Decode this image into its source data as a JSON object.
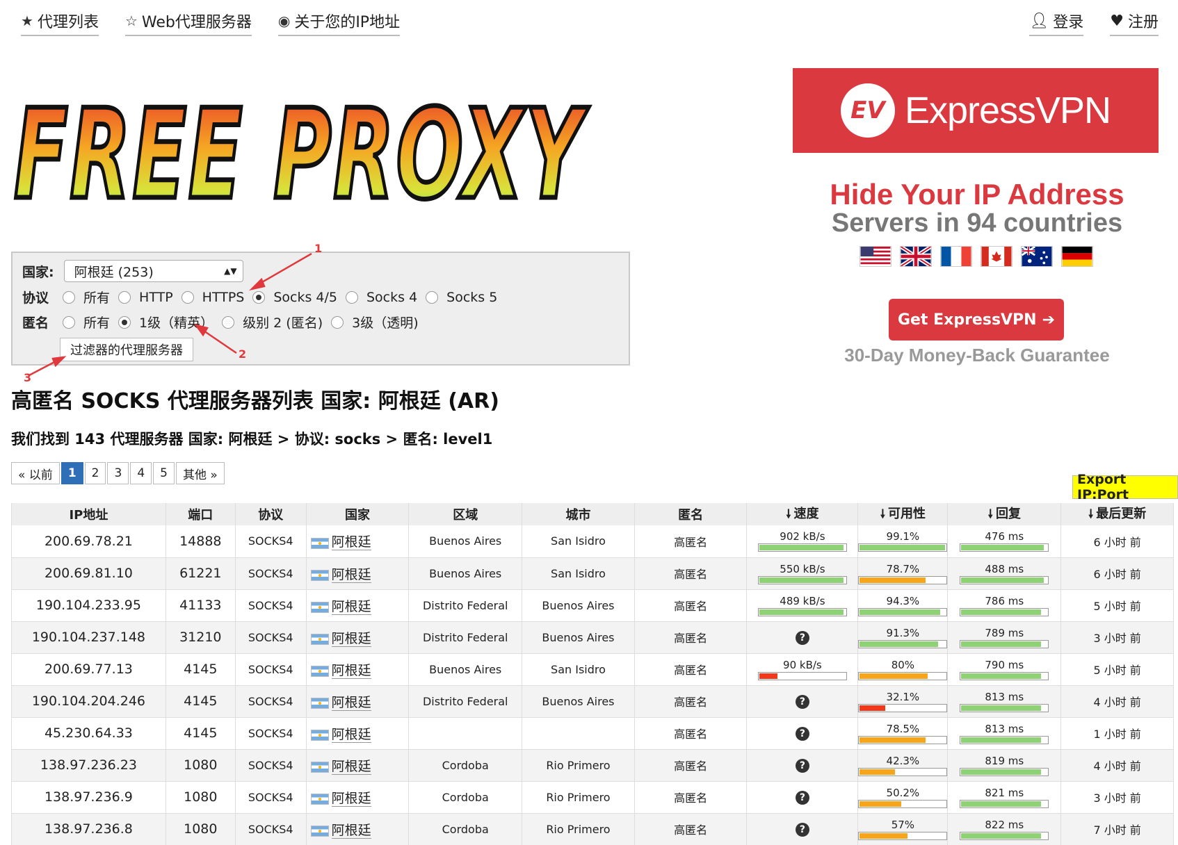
{
  "nav": {
    "left": [
      {
        "icon": "star-icon",
        "label": "代理列表"
      },
      {
        "icon": "star-outline-icon",
        "label": "Web代理服务器"
      },
      {
        "icon": "eye-icon",
        "label": "关于您的IP地址"
      }
    ],
    "right": [
      {
        "icon": "user-icon",
        "label": "登录"
      },
      {
        "icon": "heart-icon",
        "label": "注册"
      }
    ]
  },
  "logo": {
    "text": "FREE PROXY"
  },
  "ad": {
    "brand": "ExpressVPN",
    "logo_text": "EV",
    "headline": "Hide Your IP Address",
    "sub": "Servers in 94 countries",
    "cta": "Get ExpressVPN",
    "guarantee": "30-Day Money-Back Guarantee",
    "brand_color": "#da3940"
  },
  "filter": {
    "country_label": "国家:",
    "country_value": "阿根廷 (253)",
    "protocol_label": "协议",
    "protocol_options": [
      "所有",
      "HTTP",
      "HTTPS",
      "Socks 4/5",
      "Socks 4",
      "Socks 5"
    ],
    "protocol_selected": 3,
    "anon_label": "匿名",
    "anon_options": [
      "所有",
      "1级（精英）",
      "级别 2 (匿名)",
      "3级（透明)"
    ],
    "anon_selected": 1,
    "filter_button": "过滤器的代理服务器",
    "annotations": [
      "1",
      "2",
      "3"
    ]
  },
  "title": "高匿名 SOCKS 代理服务器列表 国家: 阿根廷 (AR)",
  "summary": "我们找到 143 代理服务器 国家: 阿根廷 > 协议: socks > 匿名: level1",
  "pager": {
    "prev": "« 以前",
    "pages": [
      "1",
      "2",
      "3",
      "4",
      "5"
    ],
    "active": 0,
    "next": "其他 »"
  },
  "export_label": "Export IP:Port",
  "table": {
    "headers": [
      "IP地址",
      "端口",
      "协议",
      "国家",
      "区域",
      "城市",
      "匿名",
      "速度",
      "可用性",
      "回复",
      "最后更新"
    ],
    "rows": [
      {
        "ip": "200.69.78.21",
        "port": "14888",
        "proto": "SOCKS4",
        "country": "阿根廷",
        "region": "Buenos Aires",
        "city": "San Isidro",
        "anon": "高匿名",
        "speed": "902 kB/s",
        "speed_pct": 98,
        "speed_color": "#8fd175",
        "uptime": "99.1%",
        "uptime_pct": 99,
        "uptime_color": "#8fd175",
        "resp": "476 ms",
        "resp_pct": 96,
        "resp_color": "#8fd175",
        "updated": "6 小时 前"
      },
      {
        "ip": "200.69.81.10",
        "port": "61221",
        "proto": "SOCKS4",
        "country": "阿根廷",
        "region": "Buenos Aires",
        "city": "San Isidro",
        "anon": "高匿名",
        "speed": "550 kB/s",
        "speed_pct": 98,
        "speed_color": "#8fd175",
        "uptime": "78.7%",
        "uptime_pct": 77,
        "uptime_color": "#f7a51b",
        "resp": "488 ms",
        "resp_pct": 96,
        "resp_color": "#8fd175",
        "updated": "6 小时 前"
      },
      {
        "ip": "190.104.233.95",
        "port": "41133",
        "proto": "SOCKS4",
        "country": "阿根廷",
        "region": "Distrito Federal",
        "city": "Buenos Aires",
        "anon": "高匿名",
        "speed": "489 kB/s",
        "speed_pct": 98,
        "speed_color": "#8fd175",
        "uptime": "94.3%",
        "uptime_pct": 93,
        "uptime_color": "#8fd175",
        "resp": "786 ms",
        "resp_pct": 93,
        "resp_color": "#8fd175",
        "updated": "5 小时 前"
      },
      {
        "ip": "190.104.237.148",
        "port": "31210",
        "proto": "SOCKS4",
        "country": "阿根廷",
        "region": "Distrito Federal",
        "city": "Buenos Aires",
        "anon": "高匿名",
        "speed": null,
        "uptime": "91.3%",
        "uptime_pct": 91,
        "uptime_color": "#8fd175",
        "resp": "789 ms",
        "resp_pct": 93,
        "resp_color": "#8fd175",
        "updated": "3 小时 前"
      },
      {
        "ip": "200.69.77.13",
        "port": "4145",
        "proto": "SOCKS4",
        "country": "阿根廷",
        "region": "Buenos Aires",
        "city": "San Isidro",
        "anon": "高匿名",
        "speed": "90 kB/s",
        "speed_pct": 22,
        "speed_color": "#f2371b",
        "uptime": "80%",
        "uptime_pct": 79,
        "uptime_color": "#f7a51b",
        "resp": "790 ms",
        "resp_pct": 93,
        "resp_color": "#8fd175",
        "updated": "5 小时 前"
      },
      {
        "ip": "190.104.204.246",
        "port": "4145",
        "proto": "SOCKS4",
        "country": "阿根廷",
        "region": "Distrito Federal",
        "city": "Buenos Aires",
        "anon": "高匿名",
        "speed": null,
        "uptime": "32.1%",
        "uptime_pct": 31,
        "uptime_color": "#f2371b",
        "resp": "813 ms",
        "resp_pct": 93,
        "resp_color": "#8fd175",
        "updated": "4 小时 前"
      },
      {
        "ip": "45.230.64.33",
        "port": "4145",
        "proto": "SOCKS4",
        "country": "阿根廷",
        "region": "",
        "city": "",
        "anon": "高匿名",
        "speed": null,
        "uptime": "78.5%",
        "uptime_pct": 77,
        "uptime_color": "#f7a51b",
        "resp": "813 ms",
        "resp_pct": 93,
        "resp_color": "#8fd175",
        "updated": "1 小时 前"
      },
      {
        "ip": "138.97.236.23",
        "port": "1080",
        "proto": "SOCKS4",
        "country": "阿根廷",
        "region": "Cordoba",
        "city": "Rio Primero",
        "anon": "高匿名",
        "speed": null,
        "uptime": "42.3%",
        "uptime_pct": 42,
        "uptime_color": "#f7a51b",
        "resp": "819 ms",
        "resp_pct": 93,
        "resp_color": "#8fd175",
        "updated": "4 小时 前"
      },
      {
        "ip": "138.97.236.9",
        "port": "1080",
        "proto": "SOCKS4",
        "country": "阿根廷",
        "region": "Cordoba",
        "city": "Rio Primero",
        "anon": "高匿名",
        "speed": null,
        "uptime": "50.2%",
        "uptime_pct": 49,
        "uptime_color": "#f7a51b",
        "resp": "821 ms",
        "resp_pct": 93,
        "resp_color": "#8fd175",
        "updated": "3 小时 前"
      },
      {
        "ip": "138.97.236.8",
        "port": "1080",
        "proto": "SOCKS4",
        "country": "阿根廷",
        "region": "Cordoba",
        "city": "Rio Primero",
        "anon": "高匿名",
        "speed": null,
        "uptime": "57%",
        "uptime_pct": 56,
        "uptime_color": "#f7a51b",
        "resp": "822 ms",
        "resp_pct": 93,
        "resp_color": "#8fd175",
        "updated": "7 小时 前"
      }
    ]
  }
}
